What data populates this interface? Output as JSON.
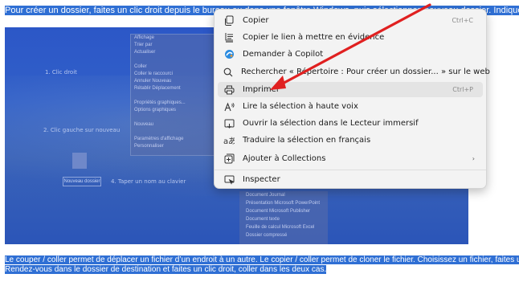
{
  "document": {
    "top_line": "Pour créer un dossier, faites un clic droit depuis le bureau ou dans une fenêtre Windows, puis sélectionnez nouveau dossier. Indiquez un nom, et appuyez",
    "bottom_lines": [
      "Le couper / coller permet de déplacer un fichier d’un endroit à un autre. Le copier / coller permet de cloner le fichier. Choisissez un fichier, faites un clic",
      "Rendez-vous dans le dossier de destination et faites un clic droit, coller dans les deux cas."
    ],
    "screenshot": {
      "step1": "1. Clic droit",
      "step2": "2. Clic gauche sur nouveau",
      "step4": "4. Taper un nom au clavier",
      "name_box": "Nouveau dossier",
      "menu1_items": [
        "Affichage",
        "Trier par",
        "Actualiser",
        "",
        "Coller",
        "Coller le raccourci",
        "Annuler Nouveau",
        "Rétablir Déplacement",
        "",
        "Propriétés graphiques...",
        "Options graphiques",
        "",
        "Nouveau",
        "",
        "Paramètres d'affichage",
        "Personnaliser"
      ],
      "menu2_items": [
        "Document Journal",
        "Présentation Microsoft PowerPoint",
        "Document Microsoft Publisher",
        "Document texte",
        "Feuille de calcul Microsoft Excel",
        "Dossier compressé"
      ]
    }
  },
  "context_menu": {
    "items": [
      {
        "label": "Copier",
        "shortcut": "Ctrl+C",
        "icon": "copy-icon"
      },
      {
        "label": "Copier le lien à mettre en évidence",
        "shortcut": "",
        "icon": "link-highlight-icon"
      },
      {
        "label": "Demander à Copilot",
        "shortcut": "",
        "icon": "copilot-icon"
      },
      {
        "label": "Rechercher « Répertoire : Pour créer un dossier... » sur le web",
        "shortcut": "",
        "icon": "search-icon"
      },
      {
        "label": "Imprimer",
        "shortcut": "Ctrl+P",
        "icon": "printer-icon"
      },
      {
        "label": "Lire la sélection à haute voix",
        "shortcut": "",
        "icon": "read-aloud-icon"
      },
      {
        "label": "Ouvrir la sélection dans le Lecteur immersif",
        "shortcut": "",
        "icon": "immersive-reader-icon"
      },
      {
        "label": "Traduire la sélection en français",
        "shortcut": "",
        "icon": "translate-icon"
      },
      {
        "label": "Ajouter à Collections",
        "shortcut": "",
        "icon": "collections-icon"
      },
      {
        "label": "Inspecter",
        "shortcut": "",
        "icon": "inspect-icon"
      }
    ],
    "submenu_arrow": "›"
  },
  "colors": {
    "selection": "#2f6fd4",
    "menu_bg": "#f3f3f3",
    "highlight": "#e4e4e4",
    "annotation_arrow": "#e02020"
  }
}
